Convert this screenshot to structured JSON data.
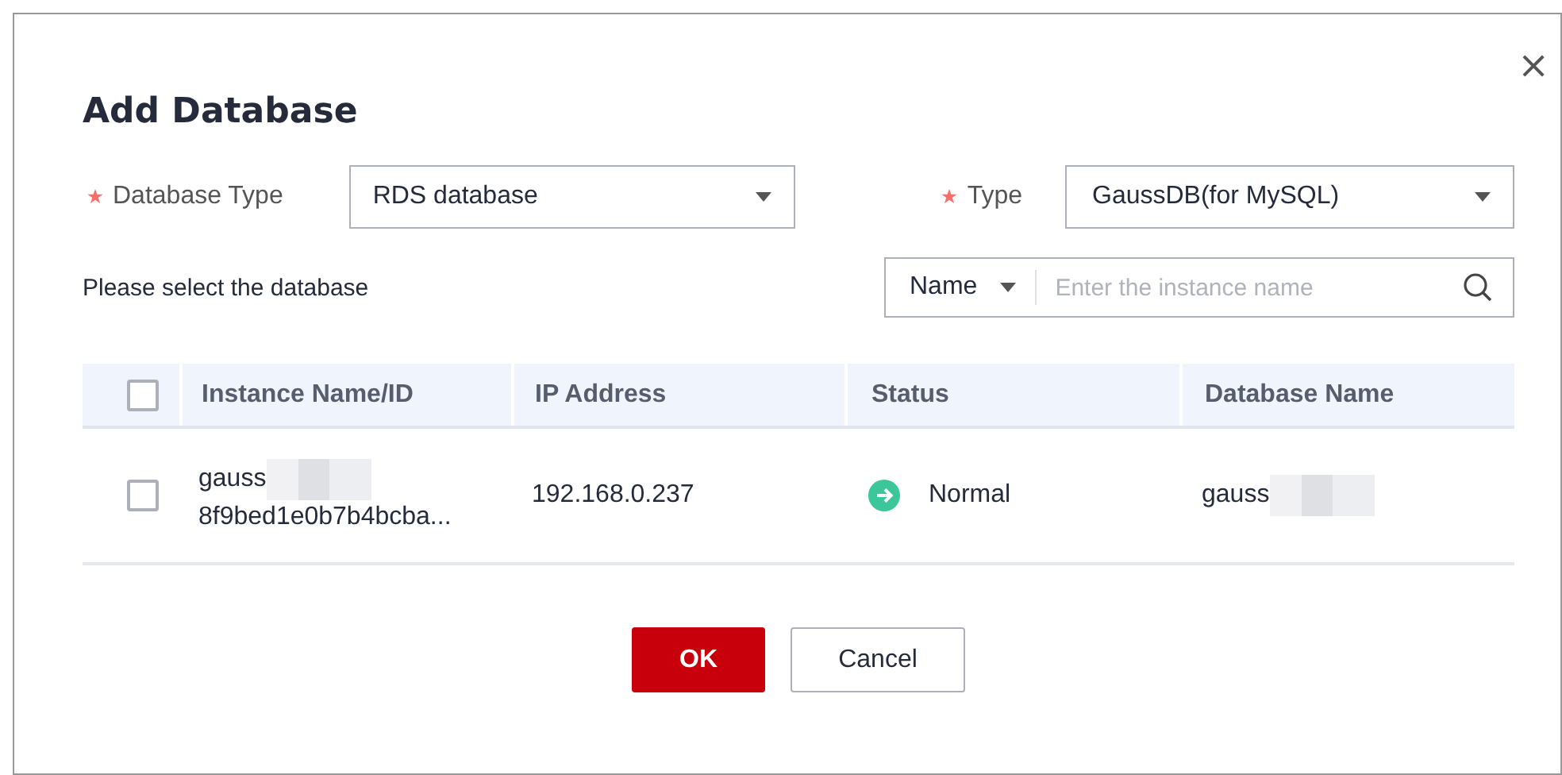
{
  "dialog": {
    "title": "Add Database",
    "close": "×"
  },
  "fields": [
    {
      "label": "Database Type",
      "required": true,
      "value": "RDS database"
    },
    {
      "label": "Type",
      "required": true,
      "value": "GaussDB(for MySQL)"
    }
  ],
  "hint": "Please select the database",
  "search": {
    "filter": "Name",
    "placeholder": "Enter the instance name"
  },
  "table": {
    "columns": [
      "Instance Name/ID",
      "IP Address",
      "Status",
      "Database Name"
    ],
    "header_checked": false,
    "rows": [
      {
        "checked": false,
        "name": "gauss",
        "id": "8f9bed1e0b7b4bcba...",
        "ip": "192.168.0.237",
        "status": "Normal",
        "color": "#3cc79a",
        "database": "gauss"
      }
    ]
  },
  "buttons": [
    {
      "label": "OK",
      "kind": "primary"
    },
    {
      "label": "Cancel",
      "kind": "secondary"
    }
  ]
}
